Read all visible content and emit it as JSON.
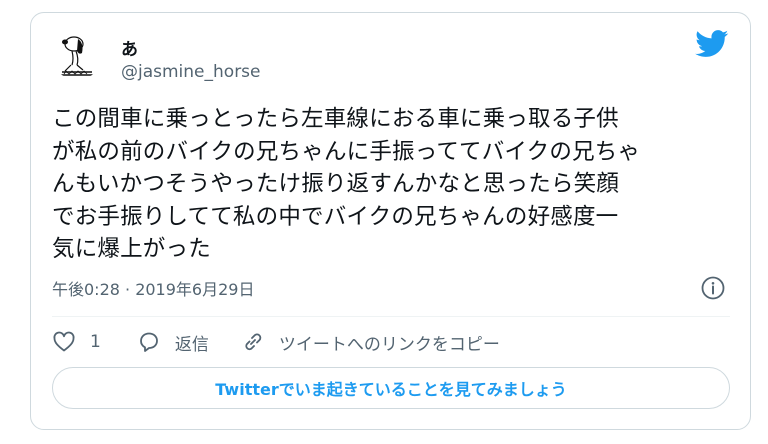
{
  "tweet": {
    "display_name": "あ",
    "handle": "@jasmine_horse",
    "avatar_icon": "snoopy-avatar-icon",
    "text": "この間車に乗っとったら左車線におる車に乗っ取る子供\nが私の前のバイクの兄ちゃんに手振っててバイクの兄ちゃ\nんもいかつそうやったけ振り返すんかなと思ったら笑顔\nでお手振りしてて私の中でバイクの兄ちゃんの好感度一\n気に爆上がった",
    "timestamp": "午後0:28 · 2019年6月29日"
  },
  "actions": {
    "like_count": "1",
    "reply_label": "返信",
    "copy_link_label": "ツイートへのリンクをコピー"
  },
  "cta": {
    "label": "Twitterでいま起きていることを見てみましょう"
  },
  "colors": {
    "twitter_blue": "#1d9bf0",
    "text": "#0f1419",
    "muted": "#536471",
    "border": "#cfd9de"
  }
}
